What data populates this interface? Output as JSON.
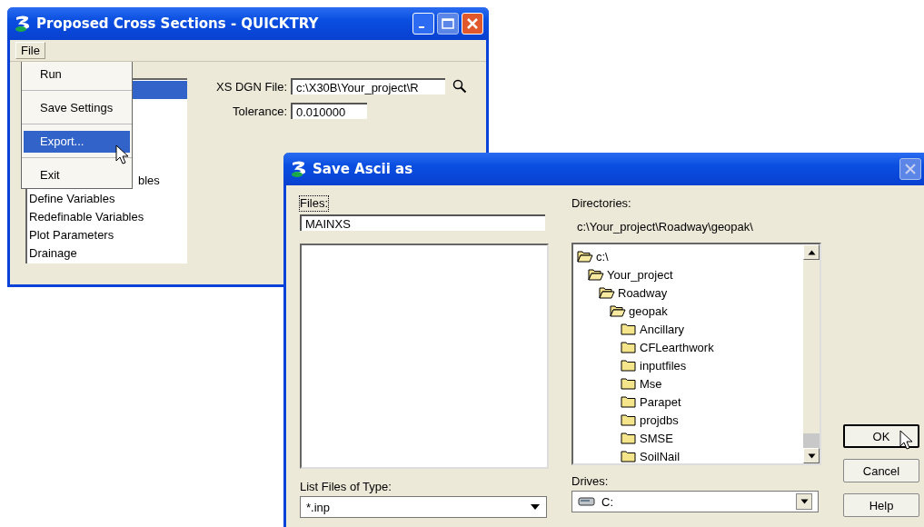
{
  "main_window": {
    "title": "Proposed Cross Sections - QUICKTRY",
    "menu_bar": [
      {
        "label": "File",
        "selected": true
      }
    ],
    "list": [
      {
        "selected": true
      },
      {
        "label": "bles",
        "selected": false
      },
      {
        "label": "Define Variables",
        "selected": false
      },
      {
        "label": "Redefinable Variables",
        "selected": false
      },
      {
        "label": "Plot Parameters",
        "selected": false
      },
      {
        "label": "Drainage",
        "selected": false
      }
    ],
    "fields": [
      {
        "label": "XS DGN File:",
        "value": "c:\\X30B\\Your_project\\R",
        "kind": "browse"
      },
      {
        "label": "Tolerance:",
        "value": "0.010000",
        "kind": "plain"
      }
    ]
  },
  "file_menu": [
    {
      "label": "Run",
      "selected": false
    },
    {
      "label": "Save Settings",
      "selected": false
    },
    {
      "label": "Export...",
      "selected": true
    },
    {
      "label": "Exit",
      "selected": false
    }
  ],
  "dialog": {
    "title": "Save Ascii as",
    "files_label": "Files:",
    "files_value": "MAINXS",
    "directories_label": "Directories:",
    "directory_path": "c:\\Your_project\\Roadway\\geopak\\",
    "tree": [
      {
        "label": "c:\\",
        "expanded": true,
        "children": [
          {
            "label": "Your_project",
            "expanded": true,
            "children": [
              {
                "label": "Roadway",
                "expanded": true,
                "children": [
                  {
                    "label": "geopak",
                    "expanded": true,
                    "children": [
                      {
                        "label": "Ancillary",
                        "expanded": false
                      },
                      {
                        "label": "CFLearthwork",
                        "expanded": false
                      },
                      {
                        "label": "inputfiles",
                        "expanded": false
                      },
                      {
                        "label": "Mse",
                        "expanded": false
                      },
                      {
                        "label": "Parapet",
                        "expanded": false
                      },
                      {
                        "label": "projdbs",
                        "expanded": false
                      },
                      {
                        "label": "SMSE",
                        "expanded": false
                      },
                      {
                        "label": "SoilNail",
                        "expanded": false
                      }
                    ]
                  }
                ]
              }
            ]
          }
        ]
      }
    ],
    "type_label": "List Files of Type:",
    "type_value": "*.inp",
    "drives_label": "Drives:",
    "drive_value": "C:",
    "buttons": [
      {
        "label": "OK",
        "default": true
      },
      {
        "label": "Cancel",
        "default": false
      },
      {
        "label": "Help",
        "default": false
      }
    ]
  }
}
